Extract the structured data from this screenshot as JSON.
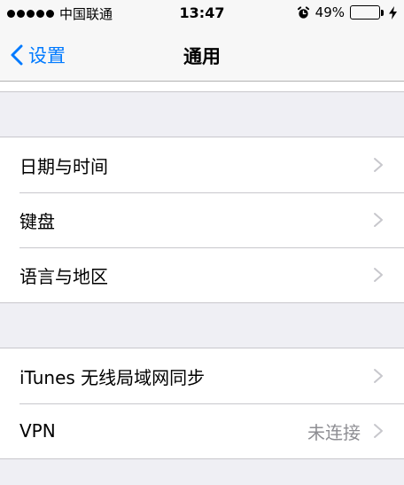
{
  "status_bar": {
    "carrier": "中国联通",
    "time": "13:47",
    "battery_percent": "49%",
    "battery_level": 0.49
  },
  "nav": {
    "back_label": "设置",
    "title": "通用"
  },
  "groups": [
    {
      "rows": [
        {
          "label": "日期与时间"
        },
        {
          "label": "键盘"
        },
        {
          "label": "语言与地区"
        }
      ]
    },
    {
      "rows": [
        {
          "label": "iTunes 无线局域网同步"
        },
        {
          "label": "VPN",
          "detail": "未连接"
        }
      ]
    }
  ],
  "colors": {
    "accent": "#007aff",
    "battery": "#4cd964",
    "background": "#efeff4"
  }
}
